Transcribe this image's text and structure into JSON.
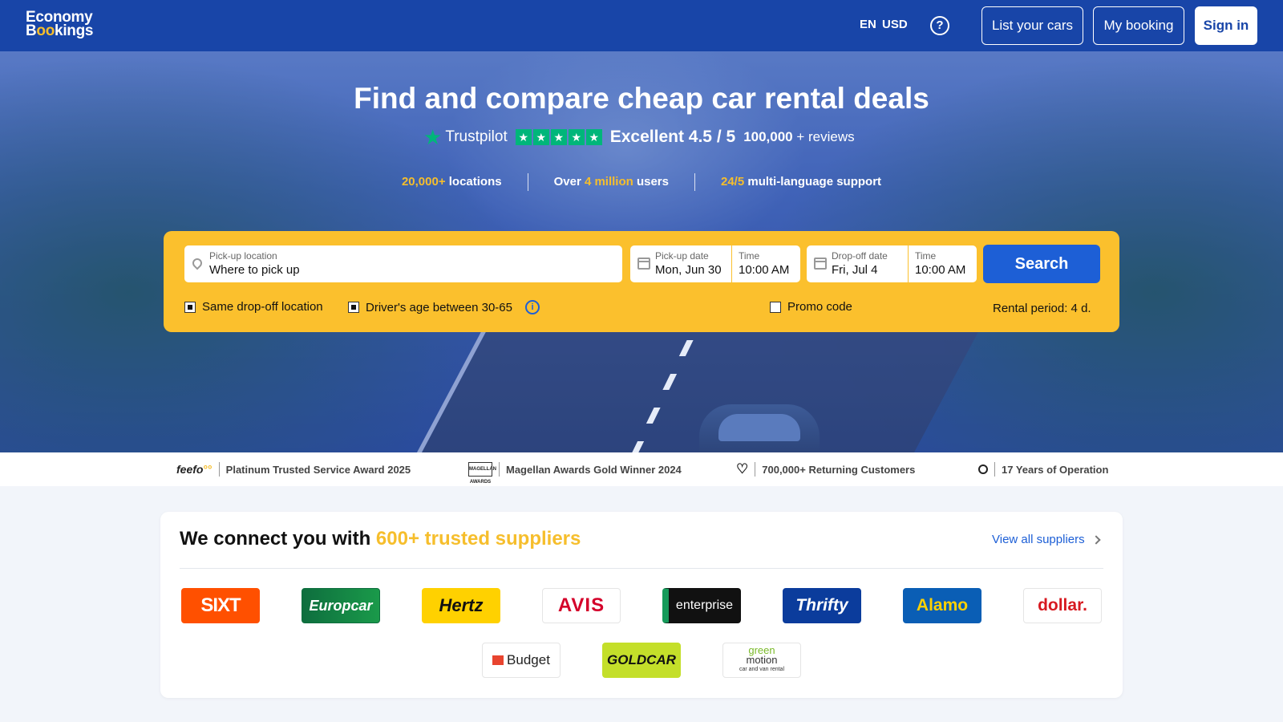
{
  "header": {
    "logo_line1": "Economy",
    "logo_line2_a": "B",
    "logo_line2_b": "oo",
    "logo_line2_c": "kings",
    "language": "EN",
    "currency": "USD",
    "help_icon": "question-circle-icon",
    "list_cars_label": "List your cars",
    "my_booking_label": "My booking",
    "sign_in_label": "Sign in"
  },
  "hero": {
    "title": "Find and compare cheap car rental deals",
    "trustpilot_name": "Trustpilot",
    "rating_text": "Excellent 4.5 / 5",
    "reviews_count": "100,000",
    "reviews_suffix": "+ reviews",
    "stats": [
      {
        "highlight": "20,000+",
        "text": " locations"
      },
      {
        "prefix": "Over ",
        "highlight": "4 million",
        "text": " users"
      },
      {
        "highlight": "24/5",
        "text": " multi-language support"
      }
    ]
  },
  "search": {
    "pickup_label": "Pick-up location",
    "pickup_placeholder": "Where to pick up",
    "pickup_date_label": "Pick-up date",
    "pickup_date": "Mon, Jun 30",
    "pickup_time_label": "Time",
    "pickup_time": "10:00 AM",
    "dropoff_date_label": "Drop-off date",
    "dropoff_date": "Fri, Jul 4",
    "dropoff_time_label": "Time",
    "dropoff_time": "10:00 AM",
    "search_label": "Search",
    "same_dropoff_label": "Same drop-off location",
    "same_dropoff_checked": true,
    "driver_age_label": "Driver's age between 30-65",
    "driver_age_checked": true,
    "promo_label": "Promo code",
    "promo_checked": false,
    "rental_period": "Rental period: 4 d."
  },
  "awards": [
    {
      "logo": "feefo",
      "text": "Platinum Trusted Service Award 2025"
    },
    {
      "logo": "MAGELLAN AWARDS",
      "text": "Magellan Awards Gold Winner 2024"
    },
    {
      "icon": "heart-icon",
      "text": "700,000+ Returning Customers"
    },
    {
      "icon": "medal-icon",
      "text": "17 Years of Operation"
    }
  ],
  "suppliers": {
    "title_prefix": "We connect you with ",
    "title_highlight": "600+ trusted suppliers",
    "view_all_label": "View all suppliers",
    "logos": [
      "SIXT",
      "Europcar",
      "Hertz",
      "AVIS",
      "enterprise",
      "Thrifty",
      "Alamo",
      "dollar.",
      "Budget",
      "GOLDCAR",
      "green",
      "motion",
      "car and van rental"
    ]
  },
  "colors": {
    "header_bg": "#1845a8",
    "accent_yellow": "#fbc02d",
    "search_button": "#1d5fd6",
    "highlight": "#f6be2c",
    "trustpilot_green": "#00b67a"
  }
}
